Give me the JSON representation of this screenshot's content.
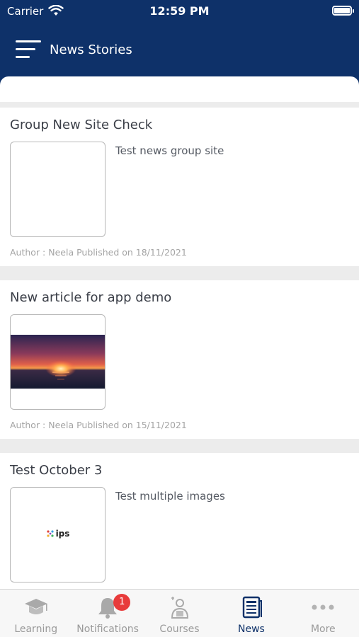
{
  "status_bar": {
    "carrier": "Carrier",
    "time": "12:59 PM"
  },
  "header": {
    "title": "News Stories"
  },
  "stories": [
    {
      "title": "Group New Site Check",
      "description": "Test news group site",
      "meta": "Author : Neela Published on 18/11/2021",
      "image": "blank"
    },
    {
      "title": "New article for app demo",
      "description": "",
      "meta": "Author : Neela Published on 15/11/2021",
      "image": "sunset"
    },
    {
      "title": "Test October 3",
      "description": "Test multiple images",
      "meta": "",
      "image": "ips-logo",
      "image_text": "ips"
    }
  ],
  "tabs": [
    {
      "label": "Learning",
      "icon": "graduation-cap-icon",
      "active": false
    },
    {
      "label": "Notifications",
      "icon": "bell-icon",
      "active": false,
      "badge": "1"
    },
    {
      "label": "Courses",
      "icon": "courses-icon",
      "active": false
    },
    {
      "label": "News",
      "icon": "news-icon",
      "active": true
    },
    {
      "label": "More",
      "icon": "more-icon",
      "active": false
    }
  ],
  "colors": {
    "header_bg": "#0e3169",
    "accent": "#0e3169",
    "badge": "#e83b3b",
    "inactive": "#9a9a9a"
  }
}
